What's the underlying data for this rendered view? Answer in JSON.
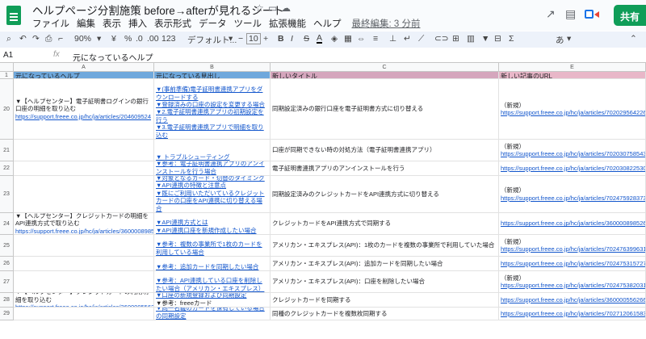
{
  "app": {
    "title": "ヘルプページ分割施策 before→afterが見れるシート",
    "last_edit": "最終編集: 3 分前",
    "share": "共有"
  },
  "menu": [
    "ファイル",
    "編集",
    "表示",
    "挿入",
    "表示形式",
    "データ",
    "ツール",
    "拡張機能",
    "ヘルプ"
  ],
  "toolbar": {
    "zoom": "90%",
    "currency": "¥",
    "percent": "%",
    "dec_dec": ".0",
    "dec_inc": ".00",
    "num_format": "123",
    "font": "デフォルト...",
    "font_size": "10",
    "bold": "B",
    "italic": "I",
    "strike": "S",
    "textcolor": "A",
    "input_tool": "あ"
  },
  "formula_bar": {
    "cell_ref": "A1",
    "fx": "fx",
    "value": "元になっているヘルプ"
  },
  "columns": [
    "A",
    "B",
    "C",
    "E"
  ],
  "header_row": {
    "num": "1",
    "a": "元になっているヘルプ",
    "b": "元になっている見出し",
    "c": "新しいタイトル",
    "e": "新しい記事のURL"
  },
  "rows": [
    {
      "num": "20",
      "a": [
        "▼【ヘルプセンター】電子証明書ログインの銀行口座の明細を取り込む",
        "https://support.freee.co.jp/hc/ja/articles/204609524"
      ],
      "b": [
        "▼(事前準備)電子証明書連携アプリをダウンロードする",
        "▼登録済みの口座の設定を変更する場合",
        "▼2.電子証明書連携アプリの初期設定を行う",
        "▼3.電子証明書連携アプリで明細を取り込む"
      ],
      "c": "同期設定済みの銀行口座を電子証明書方式に切り替える",
      "e": [
        "（新規）",
        "https://support.freee.co.jp/hc/ja/articles/7020295642265"
      ]
    },
    {
      "num": "21",
      "a": [],
      "b": [
        "▼ トラブルシューティング"
      ],
      "c": "口座が同期できない時の対処方法（電子証明書連携アプリ）",
      "e": [
        "（新規）",
        "https://support.freee.co.jp/hc/ja/articles/7020307585433"
      ]
    },
    {
      "num": "22",
      "a": [],
      "b": [
        "▼参考：電子証明書連携アプリのアンインストールを行う場合"
      ],
      "c": "電子証明書連携アプリのアンインストールを行う",
      "e": [
        "https://support.freee.co.jp/hc/ja/articles/7020308225305"
      ]
    },
    {
      "num": "23",
      "a": [],
      "b": [
        "▼対象となるカード・切替のタイミング",
        "▼API連携の特徴と注意点",
        "▼既にご利用いただいているクレジットカードの口座をAPI連携に切り替える場合"
      ],
      "c": "同期設定済みのクレジットカードをAPI連携方式に切り替える",
      "e": [
        "（新規）",
        "https://support.freee.co.jp/hc/ja/articles/7024759283737"
      ]
    },
    {
      "num": "24",
      "a": [
        "▼【ヘルプセンター】クレジットカードの明細をAPI連携方式で取り込む",
        "https://support.freee.co.jp/hc/ja/articles/360000898526"
      ],
      "b": [
        "▼API連携方式とは",
        "▼API連携口座を新規作成したい場合"
      ],
      "c": "クレジットカードをAPI連携方式で同期する",
      "e": [
        "https://support.freee.co.jp/hc/ja/articles/360000898526"
      ]
    },
    {
      "num": "25",
      "a": [],
      "b": [
        "▼参考：複数の事業所で1枚のカードを利用している場合"
      ],
      "c": "アメリカン・エキスプレス(API)：1枚のカードを複数の事業所で利用していた場合",
      "e": [
        "（新規）",
        "https://support.freee.co.jp/hc/ja/articles/7024763996313"
      ]
    },
    {
      "num": "26",
      "a": [],
      "b": [
        "▼参考：追加カードを同期したい場合"
      ],
      "c": "アメリカン・エキスプレス(API)：追加カードを同期したい場合",
      "e": [
        "https://support.freee.co.jp/hc/ja/articles/7024753157273"
      ]
    },
    {
      "num": "27",
      "a": [],
      "b": [
        "▼参考：API連携している口座を削除したい場合（アメリカン・エキスプレス）"
      ],
      "c": "アメリカン・エキスプレス(API)：口座を削除したい場合",
      "e": [
        "（新規）",
        "https://support.freee.co.jp/hc/ja/articles/7024753820313"
      ]
    },
    {
      "num": "28",
      "a": [
        "▼【ヘルプセンター】クレジットカードの利用明細を取り込む",
        "https://support.freee.co.jp/hc/ja/articles/360000556266"
      ],
      "b": [
        "▼口座の新規登録および同期設定",
        "▼参考：freeeカード"
      ],
      "c": "クレジットカードを同期する",
      "e": [
        "https://support.freee.co.jp/hc/ja/articles/360000556266"
      ]
    },
    {
      "num": "29",
      "a": [],
      "b": [
        "▼同一名義のカードを保有している場合の同期設定"
      ],
      "c": "同種のクレジットカードを複数枚同期する",
      "e": [
        "https://support.freee.co.jp/hc/ja/articles/7027120615833"
      ]
    }
  ]
}
